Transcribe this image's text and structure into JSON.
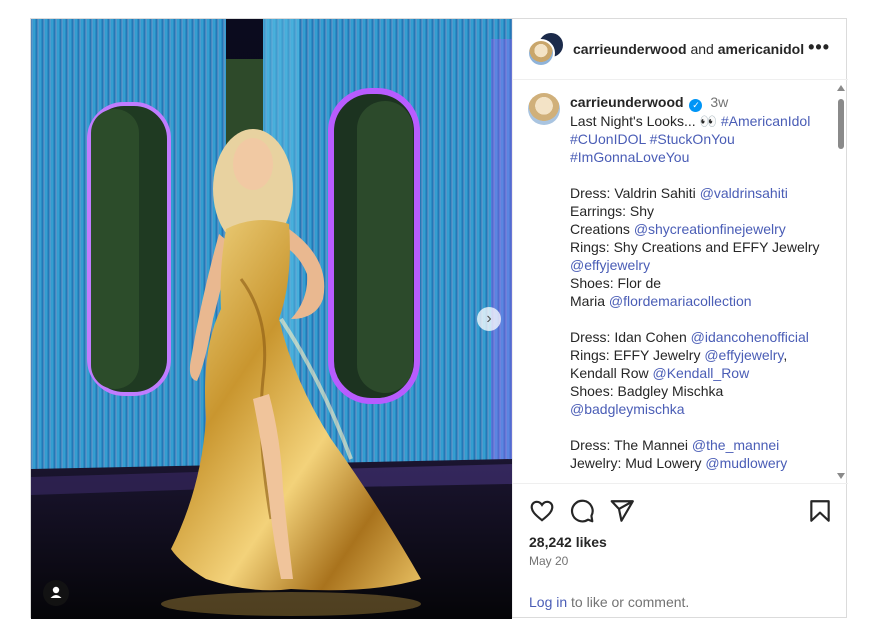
{
  "header": {
    "username": "carrieunderwood",
    "joiner": "and",
    "collaborator": "americanidol",
    "more_icon": "more-horizontal-icon"
  },
  "caption": {
    "username": "carrieunderwood",
    "verified_icon": "verified-badge-icon",
    "time": "3w",
    "line1": "Last Night's Looks... 👀",
    "hashtags1": "#AmericanIdol",
    "hashtags2": "#CUonIDOL #StuckOnYou",
    "hashtags3": "#ImGonnaLoveYou",
    "look1": {
      "dress": "Dress: Valdrin Sahiti",
      "dress_tag": "@valdrinsahiti",
      "earrings": "Earrings: Shy",
      "earrings2": "Creations",
      "earrings_tag": "@shycreationfinejewelry",
      "rings": "Rings: Shy Creations and EFFY Jewelry",
      "rings_tag": "@effyjewelry",
      "shoes": "Shoes: Flor de",
      "shoes2": "Maria",
      "shoes_tag": "@flordemariacollection"
    },
    "look2": {
      "dress": "Dress: Idan Cohen",
      "dress_tag": "@idancohenofficial",
      "rings": "Rings: EFFY Jewelry",
      "rings_tag": "@effyjewelry",
      "rings_sep": ",",
      "rings2": "Kendall Row",
      "rings2_tag": "@Kendall_Row",
      "shoes": "Shoes: Badgley Mischka",
      "shoes_tag": "@badgleymischka"
    },
    "look3": {
      "dress": "Dress: The Mannei",
      "dress_tag": "@the_mannei",
      "jewelry": "Jewelry: Mud Lowery",
      "jewelry_tag": "@mudlowery"
    }
  },
  "actions": {
    "like_icon": "heart-icon",
    "comment_icon": "comment-icon",
    "share_icon": "share-icon",
    "save_icon": "bookmark-icon",
    "likes": "28,242 likes",
    "date": "May 20",
    "login_link": "Log in",
    "login_text": "to like or comment."
  },
  "media": {
    "next_icon": "chevron-right-icon",
    "tag_icon": "user-tag-icon",
    "colors": {
      "backdrop_blue": "#2f8fc8",
      "neon_purple": "#b85cff",
      "gown_gold": "#d9b04a"
    }
  }
}
